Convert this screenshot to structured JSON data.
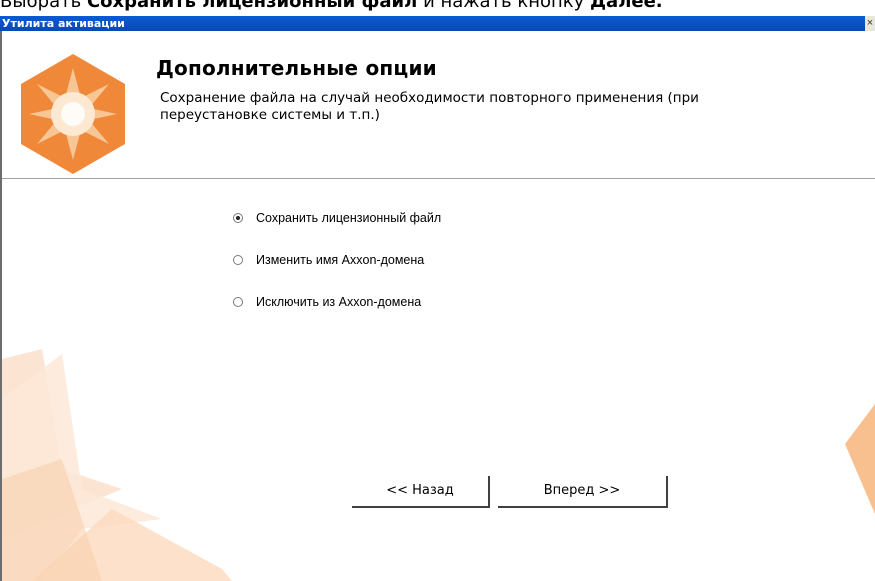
{
  "doc_fragment": {
    "prefix": "Выбрать ",
    "bold1": "Сохранить лицензионный файл",
    "middle": " и нажать кнопку ",
    "bold2": "Далее."
  },
  "window": {
    "title": "Утилита активации",
    "close_glyph": "×"
  },
  "header": {
    "title": "Дополнительные опции",
    "description": "Сохранение файла на случай необходимости повторного применения (при переустановке системы и т.п.)"
  },
  "options": [
    {
      "label": "Сохранить лицензионный файл",
      "checked": true
    },
    {
      "label": "Изменить имя Axxon-домена",
      "checked": false
    },
    {
      "label": "Исключить из Axxon-домена",
      "checked": false
    }
  ],
  "buttons": {
    "back": "<< Назад",
    "next": "Вперед >>"
  },
  "colors": {
    "accent_orange": "#f0883a",
    "titlebar_blue": "#0b5bd3"
  }
}
